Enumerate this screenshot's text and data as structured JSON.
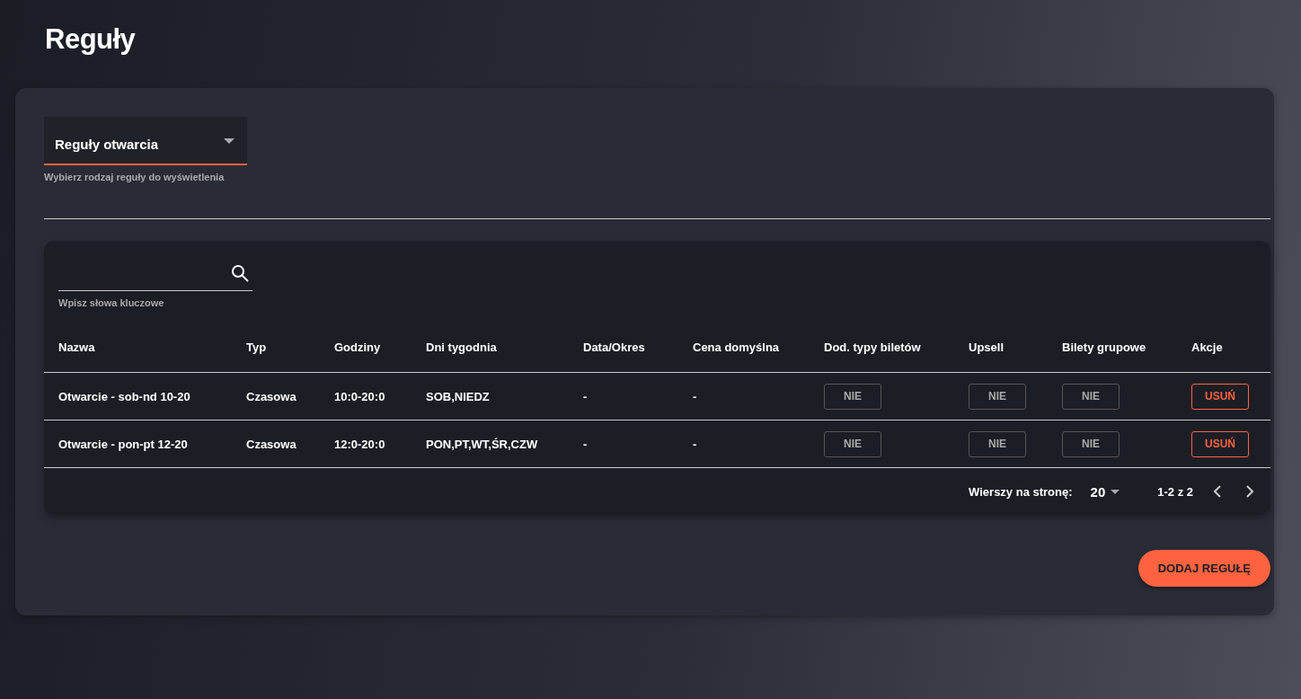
{
  "page": {
    "title": "Reguły"
  },
  "rule_type_select": {
    "value": "Reguły otwarcia",
    "helper": "Wybierz rodzaj reguły do wyświetlenia"
  },
  "search": {
    "helper": "Wpisz słowa kluczowe"
  },
  "table": {
    "columns": [
      "Nazwa",
      "Typ",
      "Godziny",
      "Dni tygodnia",
      "Data/Okres",
      "Cena domyślna",
      "Dod. typy biletów",
      "Upsell",
      "Bilety grupowe",
      "Akcje"
    ],
    "rows": [
      [
        {
          "kind": "text",
          "text": "Otwarcie - sob-nd 10-20"
        },
        {
          "kind": "text",
          "text": "Czasowa"
        },
        {
          "kind": "text",
          "text": "10:0-20:0"
        },
        {
          "kind": "text",
          "text": "SOB,NIEDZ"
        },
        {
          "kind": "text",
          "text": "-"
        },
        {
          "kind": "text",
          "text": "-"
        },
        {
          "kind": "toggle",
          "text": "NIE"
        },
        {
          "kind": "toggle",
          "text": "NIE"
        },
        {
          "kind": "toggle",
          "text": "NIE"
        },
        {
          "kind": "action",
          "text": "USUŃ"
        }
      ],
      [
        {
          "kind": "text",
          "text": "Otwarcie - pon-pt 12-20"
        },
        {
          "kind": "text",
          "text": "Czasowa"
        },
        {
          "kind": "text",
          "text": "12:0-20:0"
        },
        {
          "kind": "text",
          "text": "PON,PT,WT,ŚR,CZW"
        },
        {
          "kind": "text",
          "text": "-"
        },
        {
          "kind": "text",
          "text": "-"
        },
        {
          "kind": "toggle",
          "text": "NIE"
        },
        {
          "kind": "toggle",
          "text": "NIE"
        },
        {
          "kind": "toggle",
          "text": "NIE"
        },
        {
          "kind": "action",
          "text": "USUŃ"
        }
      ]
    ]
  },
  "pagination": {
    "rows_per_page_label": "Wierszy na stronę:",
    "rows_per_page": "20",
    "range": "1-2 z 2"
  },
  "add_button": "DODAJ REGUŁĘ"
}
